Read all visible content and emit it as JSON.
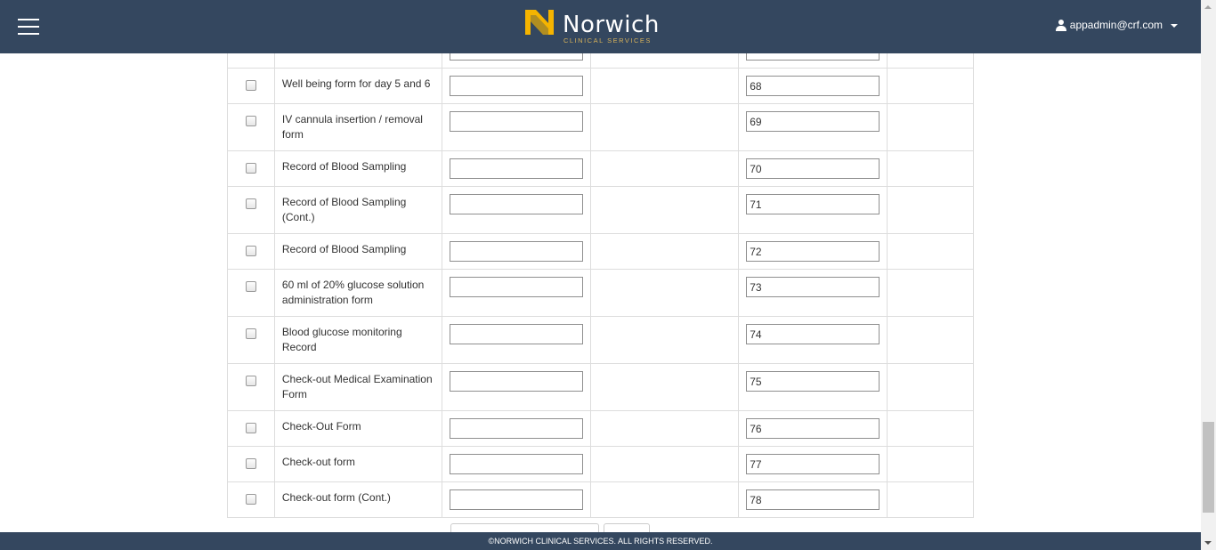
{
  "header": {
    "brand_name": "Norwich",
    "brand_sub": "CLINICAL SERVICES",
    "user": "appadmin@crf.com",
    "colors": {
      "bar": "#34475f",
      "logo_accent": "#f5b400"
    }
  },
  "icons": {
    "menu": "hamburger-icon",
    "user": "user-icon",
    "caret": "caret-down-icon"
  },
  "table": {
    "partial_top_row": {
      "input1": "",
      "input2": ""
    },
    "rows": [
      {
        "name": "Well being form for day 5 and 6",
        "input1": "",
        "input2": "68"
      },
      {
        "name": "IV cannula insertion / removal form",
        "input1": "",
        "input2": "69"
      },
      {
        "name": "Record of Blood Sampling",
        "input1": "",
        "input2": "70"
      },
      {
        "name": "Record of Blood Sampling (Cont.)",
        "input1": "",
        "input2": "71"
      },
      {
        "name": "Record of Blood Sampling",
        "input1": "",
        "input2": "72"
      },
      {
        "name": "60 ml of 20% glucose solution administration form",
        "input1": "",
        "input2": "73"
      },
      {
        "name": "Blood glucose monitoring Record",
        "input1": "",
        "input2": "74"
      },
      {
        "name": "Check-out Medical Examination Form",
        "input1": "",
        "input2": "75"
      },
      {
        "name": "Check-Out Form",
        "input1": "",
        "input2": "76"
      },
      {
        "name": "Check-out form",
        "input1": "",
        "input2": "77"
      },
      {
        "name": "Check-out form (Cont.)",
        "input1": "",
        "input2": "78"
      }
    ]
  },
  "footer": {
    "text": "©NORWICH CLINICAL SERVICES. ALL RIGHTS RESERVED."
  }
}
